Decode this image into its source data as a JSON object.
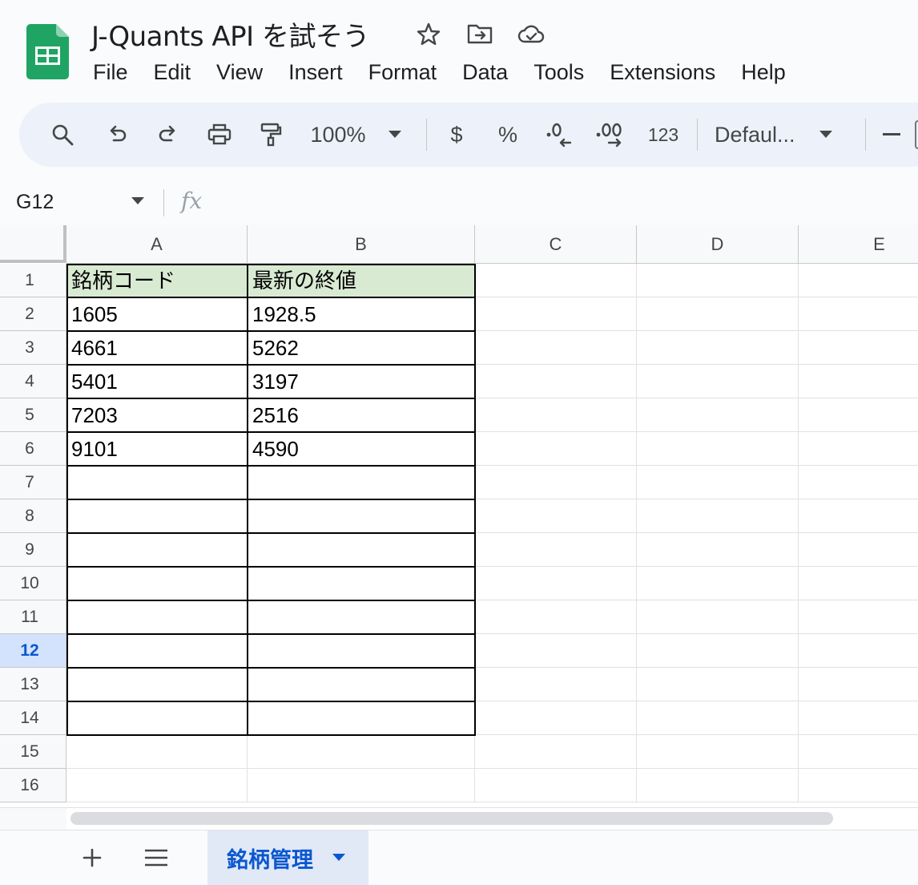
{
  "document": {
    "title": "J-Quants API を試そう"
  },
  "menu": {
    "items": [
      "File",
      "Edit",
      "View",
      "Insert",
      "Format",
      "Data",
      "Tools",
      "Extensions",
      "Help"
    ]
  },
  "toolbar": {
    "zoom": "100%",
    "currency_label": "$",
    "percent_label": "%",
    "number_format_label": "123",
    "font_name": "Defaul..."
  },
  "formula_bar": {
    "cell_reference": "G12",
    "fx_label": "fx",
    "formula": ""
  },
  "grid": {
    "columns": [
      "A",
      "B",
      "C",
      "D",
      "E"
    ],
    "rows": [
      "1",
      "2",
      "3",
      "4",
      "5",
      "6",
      "7",
      "8",
      "9",
      "10",
      "11",
      "12",
      "13",
      "14",
      "15",
      "16"
    ],
    "selected_row": "12",
    "cells": [
      [
        "銘柄コード",
        "最新の終値"
      ],
      [
        "1605",
        "1928.5"
      ],
      [
        "4661",
        "5262"
      ],
      [
        "5401",
        "3197"
      ],
      [
        "7203",
        "2516"
      ],
      [
        "9101",
        "4590"
      ]
    ],
    "header_fill": "#d9ead3"
  },
  "sheets": {
    "tabs": [
      {
        "label": "銘柄管理",
        "active": true
      }
    ]
  },
  "colors": {
    "accent": "#0b57d0",
    "toolbar_bg": "#edf2fa",
    "sheets_green": "#1fa463"
  }
}
